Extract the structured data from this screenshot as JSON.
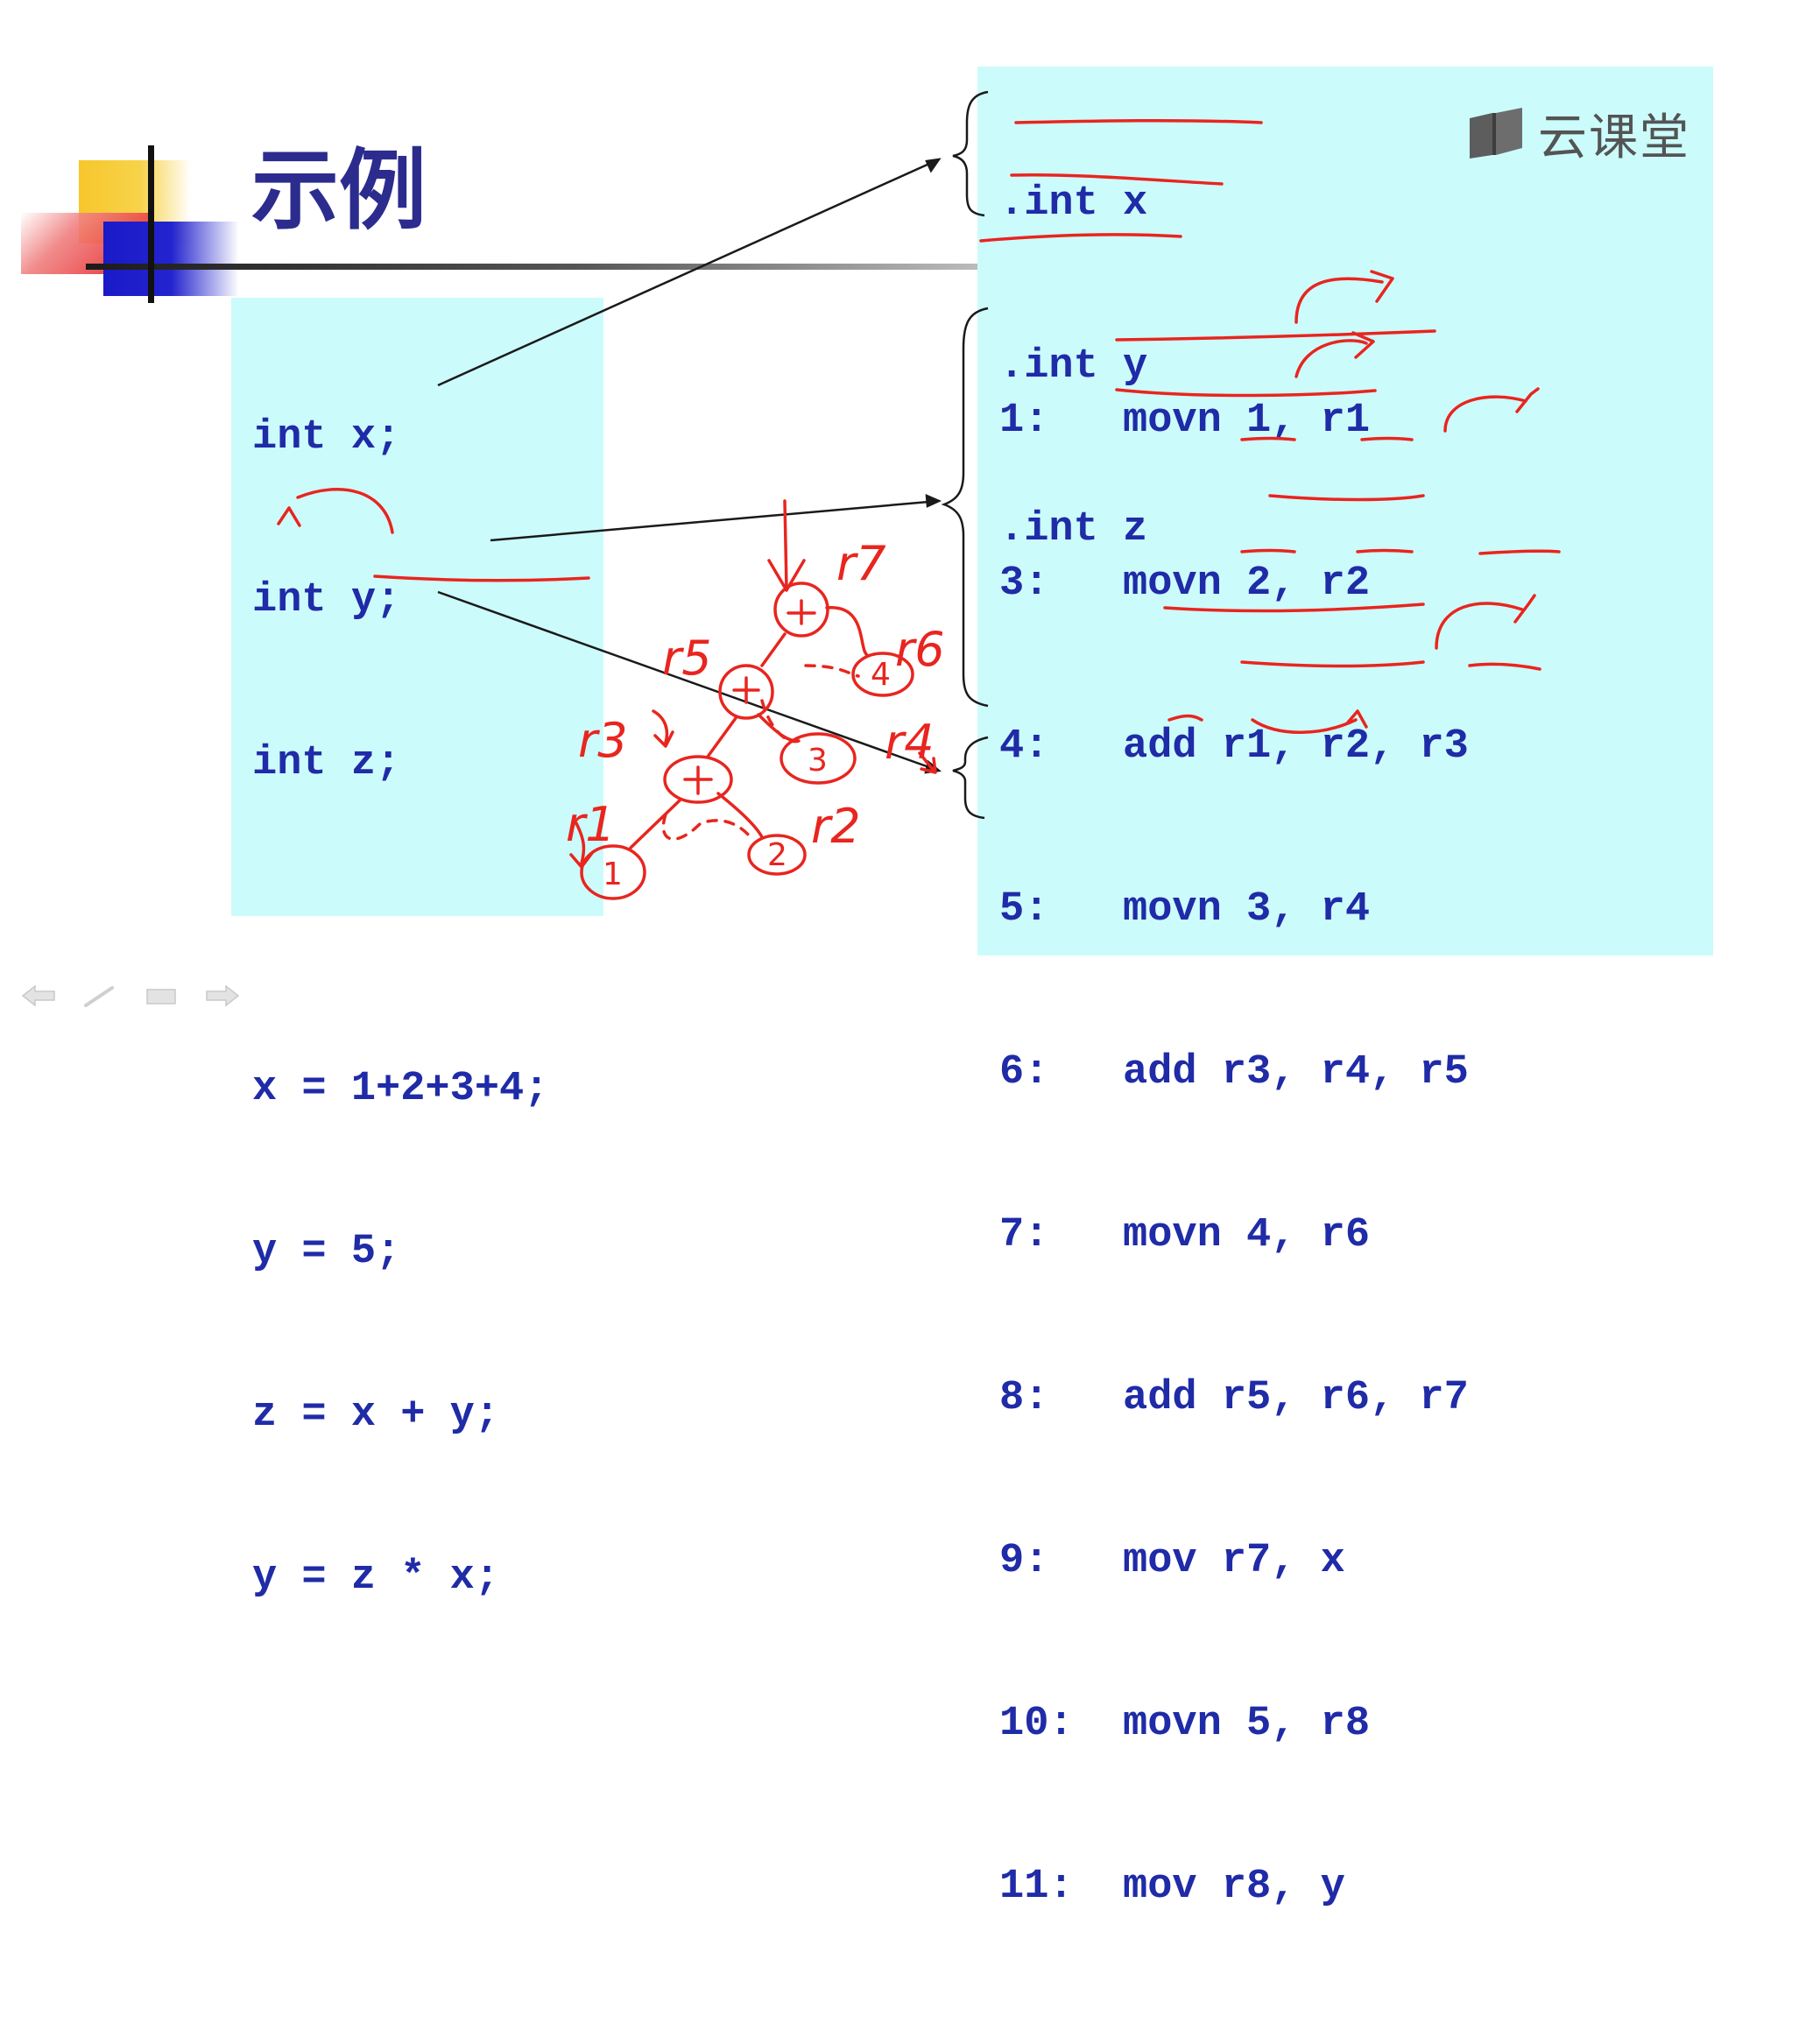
{
  "slide": {
    "title": "示例"
  },
  "source_code": {
    "lines": [
      "int x;",
      "int y;",
      "int z;",
      "",
      "x = 1+2+3+4;",
      "y = 5;",
      "z = x + y;",
      "y = z * x;"
    ]
  },
  "asm": {
    "declarations": [
      ".int x",
      ".int y",
      ".int z"
    ],
    "instructions": [
      "1:   movn 1, r1",
      "3:   movn 2, r2",
      "4:   add r1, r2, r3",
      "5:   movn 3, r4",
      "6:   add r3, r4, r5",
      "7:   movn 4, r6",
      "8:   add r5, r6, r7",
      "9:   mov r7, x",
      "10:  movn 5, r8",
      "11:  mov r8, y"
    ]
  },
  "logo": {
    "text": "云课堂",
    "icon": "book-icon"
  },
  "annotations": {
    "registers": [
      "r7",
      "r6",
      "r5",
      "r4",
      "r3",
      "r2",
      "r1"
    ],
    "nodes": [
      "+",
      "+",
      "+",
      "4",
      "3",
      "1",
      "2"
    ],
    "color": "#e8251f"
  },
  "navigation": {
    "icons": [
      "arrow-left-icon",
      "pen-icon",
      "menu-icon",
      "arrow-right-icon"
    ]
  },
  "colors": {
    "code": "#1f2ba7",
    "panel": "#ccfbfb",
    "title": "#2c2c8e",
    "ink": "#e8251f"
  }
}
